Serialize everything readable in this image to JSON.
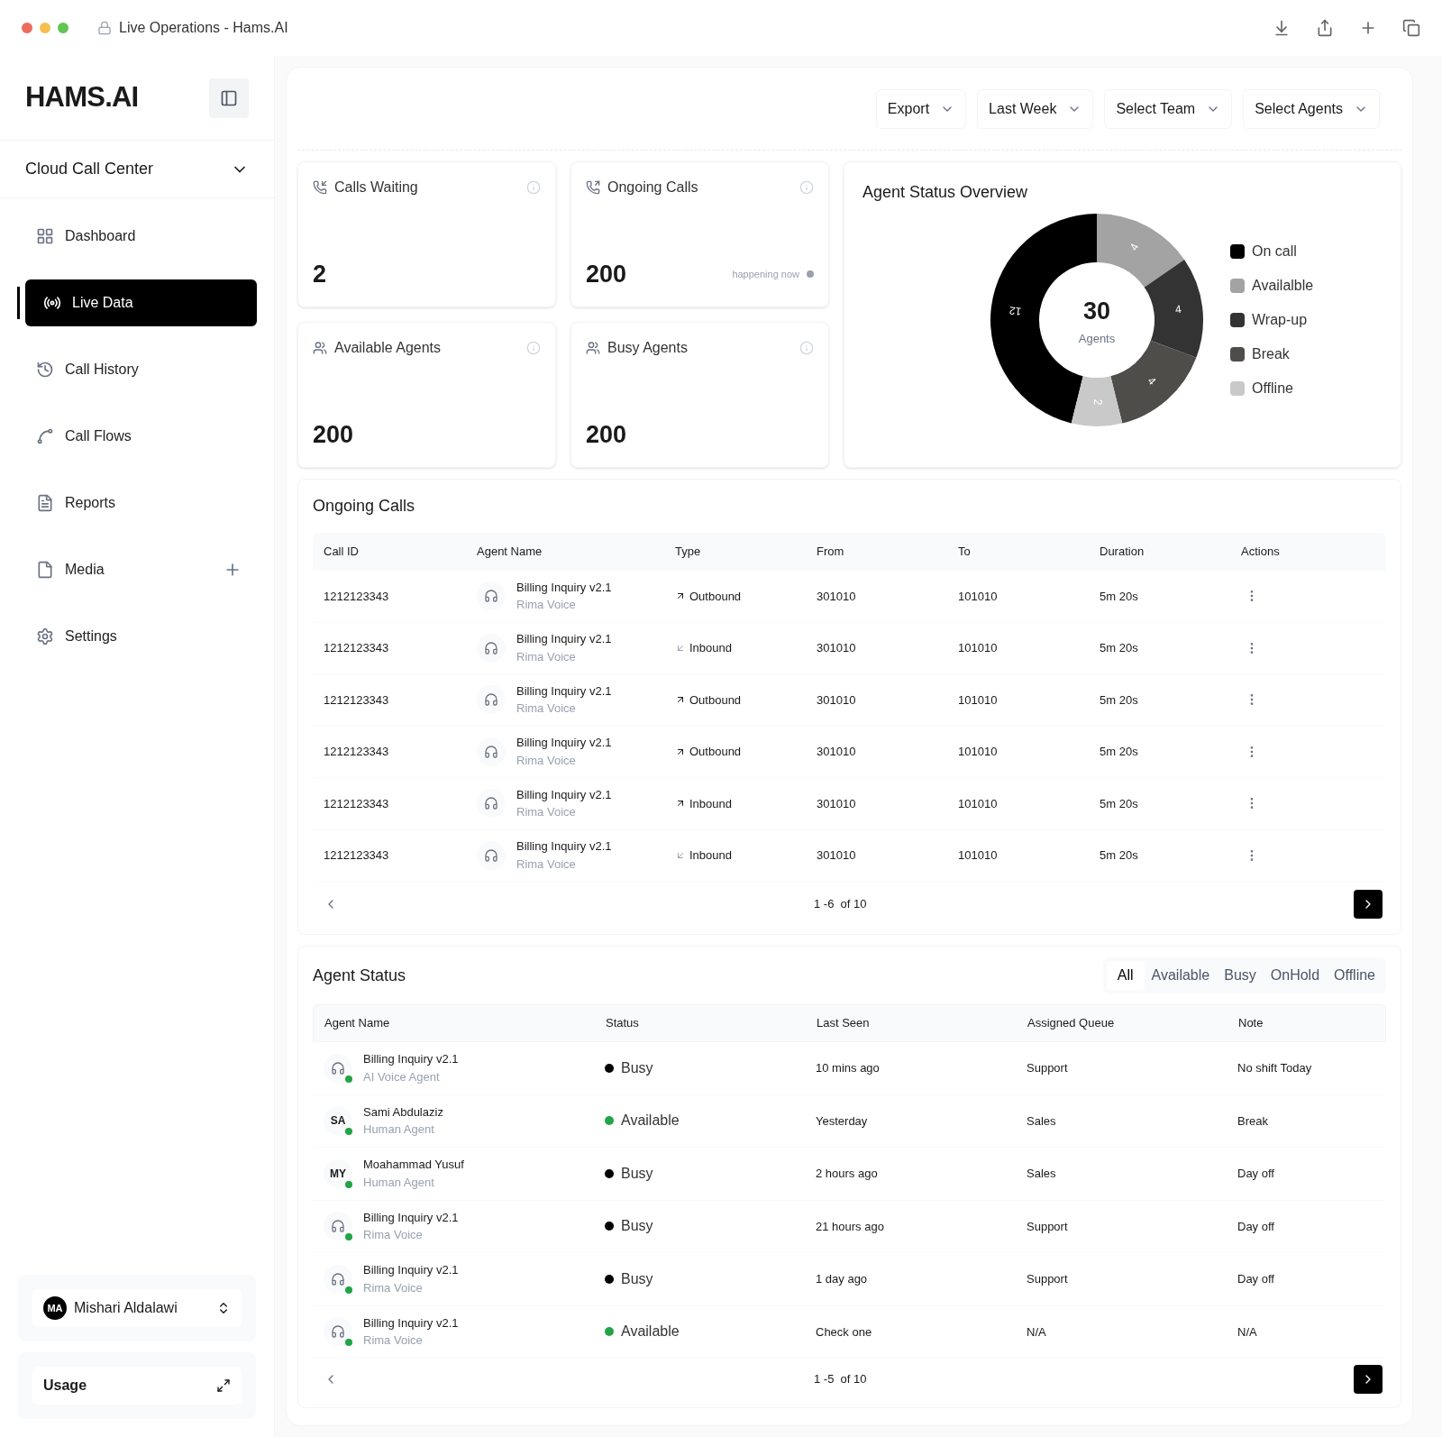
{
  "window": {
    "title": "Live Operations - Hams.AI"
  },
  "sidebar": {
    "logo": "HAMS.AI",
    "workspace": "Cloud Call Center",
    "items": [
      {
        "label": "Dashboard",
        "selected": false,
        "addable": false
      },
      {
        "label": "Live Data",
        "selected": true,
        "addable": false
      },
      {
        "label": "Call History",
        "selected": false,
        "addable": false
      },
      {
        "label": "Call Flows",
        "selected": false,
        "addable": false
      },
      {
        "label": "Reports",
        "selected": false,
        "addable": false
      },
      {
        "label": "Media",
        "selected": false,
        "addable": true
      },
      {
        "label": "Settings",
        "selected": false,
        "addable": false
      }
    ],
    "user": {
      "initials": "MA",
      "name": "Mishari Aldalawi"
    },
    "usage": "Usage"
  },
  "filters": [
    "Export",
    "Last Week",
    "Select Team",
    "Select Agents"
  ],
  "stats": [
    {
      "label": "Calls Waiting",
      "value": "2"
    },
    {
      "label": "Ongoing Calls",
      "value": "200",
      "note": "happening now"
    },
    {
      "label": "Available Agents",
      "value": "200"
    },
    {
      "label": "Busy Agents",
      "value": "200"
    }
  ],
  "overview": {
    "title": "Agent Status Overview",
    "total": "30",
    "chart_data": {
      "type": "donut",
      "categories": [
        "On call",
        "Availalble",
        "Wrap-up",
        "Break",
        "Offline"
      ],
      "series": [
        {
          "name": "Agents",
          "values": [
            12,
            4,
            4,
            4,
            2
          ]
        }
      ],
      "data_labels": true
    },
    "legend": [
      {
        "color": "#000000"
      },
      {
        "color": "#a3a3a3"
      },
      {
        "color": "#333333"
      },
      {
        "color": "#4f4d4a"
      },
      {
        "color": "#c9c9c9"
      }
    ]
  },
  "ongoing": {
    "title": "Ongoing Calls",
    "columns": [
      "Call ID",
      "Agent Name",
      "Type",
      "From",
      "To",
      "Duration",
      "Actions"
    ],
    "rows": [
      {
        "id": "1212123343",
        "agent": "Billing Inquiry v2.1",
        "sub": "Rima Voice",
        "type": "Outbound",
        "outgoing": true,
        "from": "301010",
        "to": "101010",
        "duration": "5m 20s"
      },
      {
        "id": "1212123343",
        "agent": "Billing Inquiry v2.1",
        "sub": "Rima Voice",
        "type": "Inbound",
        "outgoing": false,
        "from": "301010",
        "to": "101010",
        "duration": "5m 20s"
      },
      {
        "id": "1212123343",
        "agent": "Billing Inquiry v2.1",
        "sub": "Rima Voice",
        "type": "Outbound",
        "outgoing": true,
        "from": "301010",
        "to": "101010",
        "duration": "5m 20s"
      },
      {
        "id": "1212123343",
        "agent": "Billing Inquiry v2.1",
        "sub": "Rima Voice",
        "type": "Outbound",
        "outgoing": true,
        "from": "301010",
        "to": "101010",
        "duration": "5m 20s"
      },
      {
        "id": "1212123343",
        "agent": "Billing Inquiry v2.1",
        "sub": "Rima Voice",
        "type": "Inbound",
        "outgoing": true,
        "from": "301010",
        "to": "101010",
        "duration": "5m 20s"
      },
      {
        "id": "1212123343",
        "agent": "Billing Inquiry v2.1",
        "sub": "Rima Voice",
        "type": "Inbound",
        "outgoing": false,
        "from": "301010",
        "to": "101010",
        "duration": "5m 20s"
      }
    ],
    "pagination": "1 -6  of 10"
  },
  "agents": {
    "title": "Agent Status",
    "tabs": [
      {
        "label": "All",
        "selected": true
      },
      {
        "label": "Available",
        "selected": false
      },
      {
        "label": "Busy",
        "selected": false
      },
      {
        "label": "OnHold",
        "selected": false
      },
      {
        "label": "Offline",
        "selected": false
      }
    ],
    "columns": [
      "Agent Name",
      "Status",
      "Last Seen",
      "Assigned Queue",
      "Note"
    ],
    "rows": [
      {
        "kind": "bot",
        "name": "Billing Inquiry v2.1",
        "sub": "AI Voice Agent",
        "status": "Busy",
        "color": "#000000",
        "seen": "10 mins ago",
        "queue": "Support",
        "note": "No shift Today"
      },
      {
        "kind": "human",
        "initials": "SA",
        "name": "Sami Abdulaziz",
        "sub": "Human Agent",
        "status": "Available",
        "color": "#22a447",
        "seen": "Yesterday",
        "queue": "Sales",
        "note": "Break"
      },
      {
        "kind": "human",
        "initials": "MY",
        "name": "Moahammad Yusuf",
        "sub": "Human Agent",
        "status": "Busy",
        "color": "#000000",
        "seen": "2 hours ago",
        "queue": "Sales",
        "note": "Day off"
      },
      {
        "kind": "bot",
        "name": "Billing Inquiry v2.1",
        "sub": "Rima Voice",
        "status": "Busy",
        "color": "#000000",
        "seen": "21 hours ago",
        "queue": "Support",
        "note": "Day off"
      },
      {
        "kind": "bot",
        "name": "Billing Inquiry v2.1",
        "sub": "Rima Voice",
        "status": "Busy",
        "color": "#000000",
        "seen": "1 day ago",
        "queue": "Support",
        "note": "Day off"
      },
      {
        "kind": "bot",
        "name": "Billing Inquiry v2.1",
        "sub": "Rima Voice",
        "status": "Available",
        "color": "#22a447",
        "seen": "Check one",
        "queue": "N/A",
        "note": "N/A"
      }
    ],
    "pagination": "1 -5  of 10"
  }
}
